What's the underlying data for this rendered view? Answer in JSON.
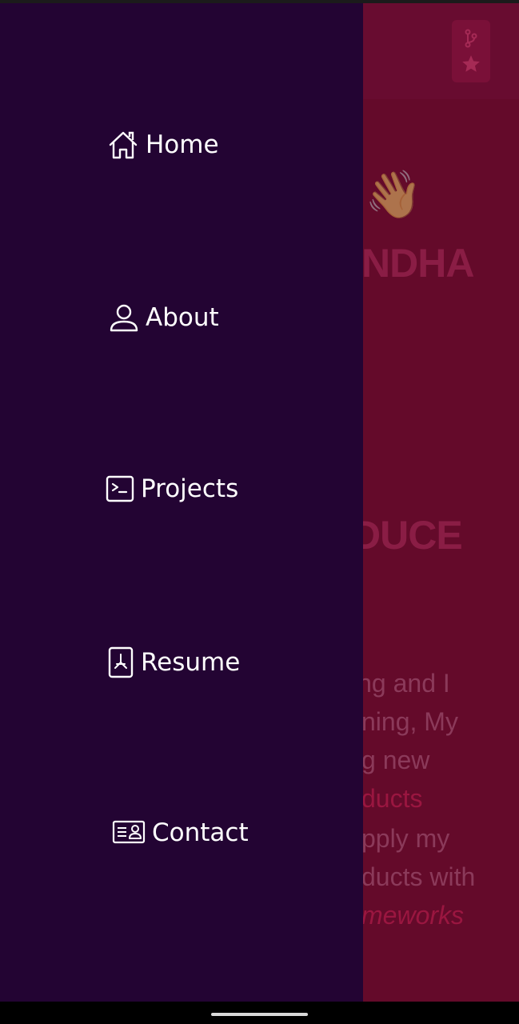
{
  "drawer": {
    "background": "#230433",
    "items": [
      {
        "label": "Home",
        "icon": "home-icon"
      },
      {
        "label": "About",
        "icon": "user-icon"
      },
      {
        "label": "Projects",
        "icon": "terminal-icon"
      },
      {
        "label": "Resume",
        "icon": "pdf-file-icon"
      },
      {
        "label": "Contact",
        "icon": "contact-card-icon"
      }
    ]
  },
  "background_page": {
    "color": "#640a2a",
    "fab_icons": [
      "git-branch-icon",
      "star-icon"
    ],
    "wave_emoji": "👋",
    "name_fragment": "NDHA",
    "heading_fragment": "DUCE",
    "paragraph_lines": [
      "ing and I",
      "ning, My",
      "g new",
      "ducts",
      "pply my",
      "ducts with",
      "meworks"
    ]
  }
}
